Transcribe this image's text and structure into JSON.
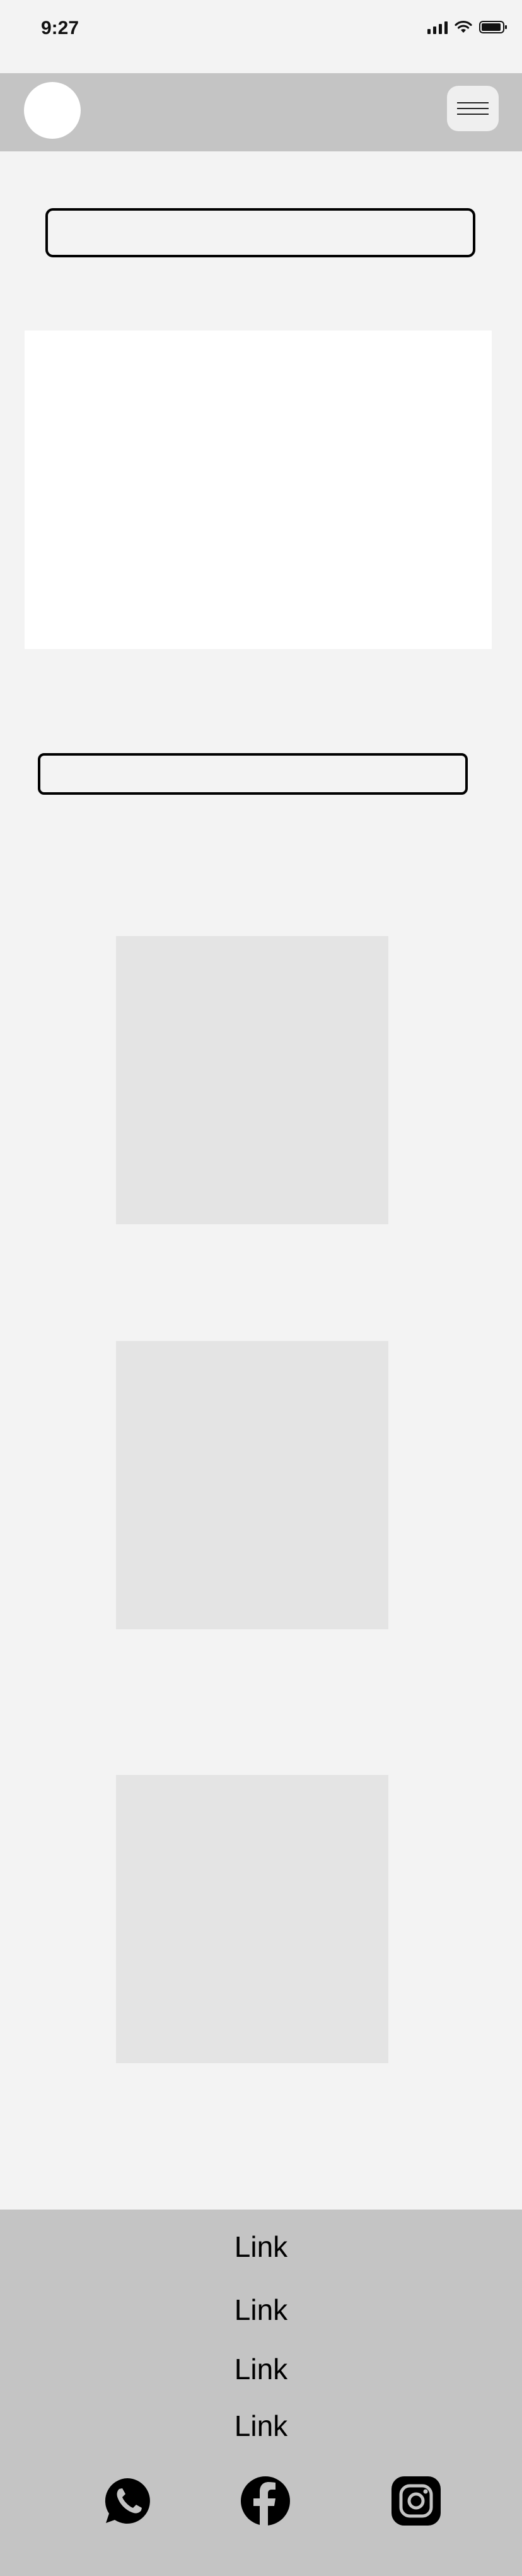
{
  "status_bar": {
    "time": "9:27",
    "icons": [
      "signal-icon",
      "wifi-icon",
      "battery-icon"
    ]
  },
  "header": {
    "logo": "logo-circle",
    "menu_icon": "hamburger-icon"
  },
  "main": {
    "search_box": {
      "value": "",
      "placeholder": ""
    },
    "hero_image": "image-placeholder",
    "text_input": {
      "value": "",
      "placeholder": ""
    },
    "cards": [
      "card-placeholder",
      "card-placeholder",
      "card-placeholder"
    ]
  },
  "footer": {
    "links": [
      "Link",
      "Link",
      "Link",
      "Link"
    ],
    "social_icons": [
      "whatsapp-icon",
      "facebook-icon",
      "instagram-icon"
    ]
  },
  "colors": {
    "page_background": "#f3f3f3",
    "bar_background": "#c4c4c4",
    "card_background": "#e4e4e4",
    "hero_background": "#ffffff",
    "text": "#000000"
  }
}
